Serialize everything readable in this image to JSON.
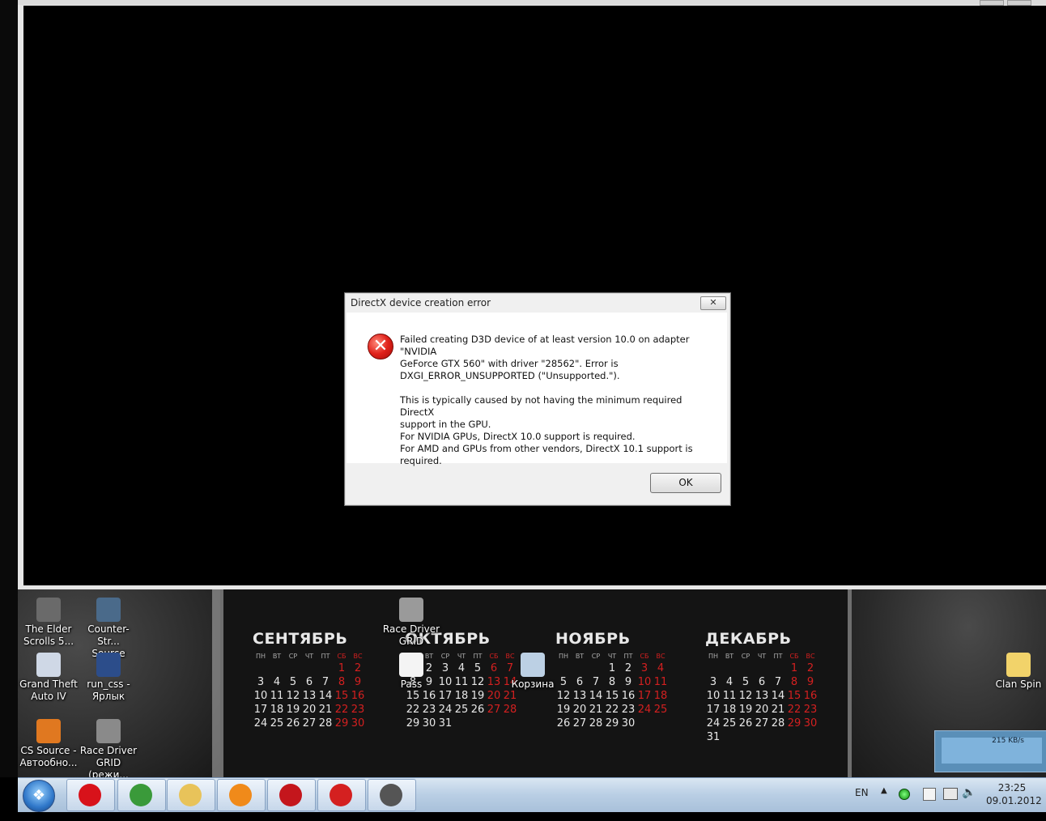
{
  "dialog": {
    "title": "DirectX device creation error",
    "close_glyph": "✕",
    "icon": "error-icon",
    "message_lines_1": [
      "Failed creating D3D device of at least version 10.0 on adapter \"NVIDIA",
      "GeForce GTX 560\" with driver \"28562\". Error is",
      "DXGI_ERROR_UNSUPPORTED (\"Unsupported.\")."
    ],
    "message_lines_2": [
      "This is typically caused by not having the minimum required DirectX",
      "support in the GPU.",
      "For NVIDIA GPUs, DirectX 10.0 support is required.",
      "For AMD and GPUs from other vendors, DirectX 10.1 support is",
      "required."
    ],
    "ok_label": "OK"
  },
  "desktop": {
    "icons": [
      {
        "label1": "The Elder",
        "label2": "Scrolls 5...",
        "icon": "skyrim-shortcut-icon",
        "color": "#6a6a6a"
      },
      {
        "label1": "Counter-Str...",
        "label2": "Source",
        "icon": "counter-strike-shortcut-icon",
        "color": "#4a6a8a"
      },
      {
        "label1": "Grand Theft",
        "label2": "Auto IV",
        "icon": "gta-shortcut-icon",
        "color": "#cfd8e6"
      },
      {
        "label1": "run_css -",
        "label2": "Ярлык",
        "icon": "run-css-shortcut-icon",
        "color": "#2c4d8a"
      },
      {
        "label1": "CS Source -",
        "label2": "Автообно...",
        "icon": "cs-update-shortcut-icon",
        "color": "#e07820"
      },
      {
        "label1": "Race Driver",
        "label2": "GRID (режи...",
        "icon": "grid-shortcut-icon",
        "color": "#8a8a8a"
      },
      {
        "label1": "Race Driver",
        "label2": "GRID",
        "icon": "grid-desktop-icon",
        "color": "#9a9a9a"
      },
      {
        "label1": "Pass",
        "label2": "",
        "icon": "text-file-icon",
        "color": "#f4f4f4"
      },
      {
        "label1": "Корзина",
        "label2": "",
        "icon": "recycle-bin-icon",
        "color": "#bcd0e4"
      },
      {
        "label1": "Clan Spin",
        "label2": "",
        "icon": "folder-icon",
        "color": "#f2d36a"
      }
    ]
  },
  "calendar": {
    "weekdays": [
      "ПН",
      "ВТ",
      "СР",
      "ЧТ",
      "ПТ",
      "СБ",
      "ВС"
    ],
    "months": [
      {
        "name": "СЕНТЯБРЬ",
        "rows": [
          [
            "",
            "",
            "",
            "",
            "",
            "1",
            "2"
          ],
          [
            "3",
            "4",
            "5",
            "6",
            "7",
            "8",
            "9"
          ],
          [
            "10",
            "11",
            "12",
            "13",
            "14",
            "15",
            "16"
          ],
          [
            "17",
            "18",
            "19",
            "20",
            "21",
            "22",
            "23"
          ],
          [
            "24",
            "25",
            "26",
            "27",
            "28",
            "29",
            "30"
          ]
        ]
      },
      {
        "name": "ОКТЯБРЬ",
        "rows": [
          [
            "1",
            "2",
            "3",
            "4",
            "5",
            "6",
            "7"
          ],
          [
            "8",
            "9",
            "10",
            "11",
            "12",
            "13",
            "14"
          ],
          [
            "15",
            "16",
            "17",
            "18",
            "19",
            "20",
            "21"
          ],
          [
            "22",
            "23",
            "24",
            "25",
            "26",
            "27",
            "28"
          ],
          [
            "29",
            "30",
            "31",
            "",
            "",
            "",
            ""
          ]
        ]
      },
      {
        "name": "НОЯБРЬ",
        "rows": [
          [
            "",
            "",
            "",
            "1",
            "2",
            "3",
            "4"
          ],
          [
            "5",
            "6",
            "7",
            "8",
            "9",
            "10",
            "11"
          ],
          [
            "12",
            "13",
            "14",
            "15",
            "16",
            "17",
            "18"
          ],
          [
            "19",
            "20",
            "21",
            "22",
            "23",
            "24",
            "25"
          ],
          [
            "26",
            "27",
            "28",
            "29",
            "30",
            "",
            ""
          ]
        ]
      },
      {
        "name": "ДЕКАБРЬ",
        "rows": [
          [
            "",
            "",
            "",
            "",
            "",
            "1",
            "2"
          ],
          [
            "3",
            "4",
            "5",
            "6",
            "7",
            "8",
            "9"
          ],
          [
            "10",
            "11",
            "12",
            "13",
            "14",
            "15",
            "16"
          ],
          [
            "17",
            "18",
            "19",
            "20",
            "21",
            "22",
            "23"
          ],
          [
            "24",
            "25",
            "26",
            "27",
            "28",
            "29",
            "30"
          ],
          [
            "31",
            "",
            "",
            "",
            "",
            "",
            ""
          ]
        ]
      }
    ]
  },
  "net_meter": {
    "value": "215 KB/s"
  },
  "taskbar": {
    "start_icon": "windows-start-orb-icon",
    "buttons": [
      {
        "icon": "opera-icon",
        "color": "#d8121a"
      },
      {
        "icon": "chrome-icon",
        "color": "#3a9a3a"
      },
      {
        "icon": "explorer-folder-icon",
        "color": "#e8c35a"
      },
      {
        "icon": "media-player-icon",
        "color": "#f08a1a"
      },
      {
        "icon": "zynga-icon",
        "color": "#c4161c"
      },
      {
        "icon": "recorder-icon",
        "color": "#d42020"
      },
      {
        "icon": "game-soldier-icon",
        "color": "#555555"
      }
    ],
    "language": "EN",
    "time": "23:25",
    "date": "09.01.2012"
  }
}
